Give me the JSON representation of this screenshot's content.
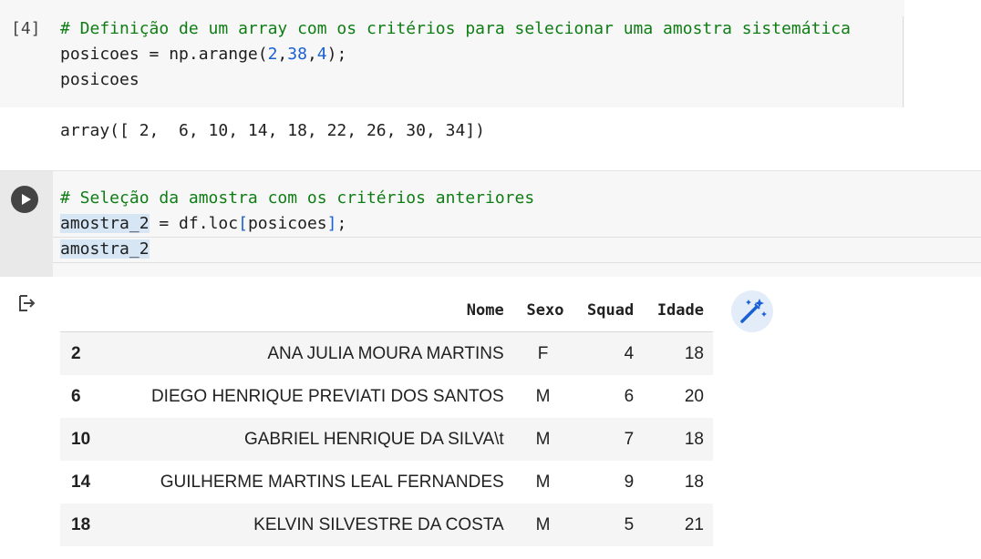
{
  "cell1": {
    "exec_count": "[4]",
    "comment": "# Definição de um array com os critérios para selecionar uma amostra sistemática",
    "line2_var": "posicoes = np.arange(",
    "line2_args": [
      "2",
      "38",
      "4"
    ],
    "line2_end": ");",
    "line3": "posicoes",
    "output": "array([ 2,  6, 10, 14, 18, 22, 26, 30, 34])"
  },
  "cell2": {
    "comment": "# Seleção da amostra com os critérios anteriores",
    "line2_var": "amostra_2",
    "line2_mid": " = df.loc",
    "line2_open": "[",
    "line2_arg": "posicoes",
    "line2_close": "]",
    "line2_end": ";",
    "line3": "amostra_2"
  },
  "table": {
    "columns": [
      "",
      "Nome",
      "Sexo",
      "Squad",
      "Idade"
    ],
    "rows": [
      {
        "idx": "2",
        "nome": "ANA JULIA MOURA MARTINS",
        "sexo": "F",
        "squad": "4",
        "idade": "18"
      },
      {
        "idx": "6",
        "nome": "DIEGO HENRIQUE PREVIATI DOS SANTOS",
        "sexo": "M",
        "squad": "6",
        "idade": "20"
      },
      {
        "idx": "10",
        "nome": "GABRIEL HENRIQUE DA SILVA\\t",
        "sexo": "M",
        "squad": "7",
        "idade": "18"
      },
      {
        "idx": "14",
        "nome": "GUILHERME MARTINS LEAL FERNANDES",
        "sexo": "M",
        "squad": "9",
        "idade": "18"
      },
      {
        "idx": "18",
        "nome": "KELVIN SILVESTRE DA COSTA",
        "sexo": "M",
        "squad": "5",
        "idade": "21"
      }
    ]
  },
  "icons": {
    "run": "play-icon",
    "output": "output-redirect-icon",
    "magic": "magic-wand-icon"
  },
  "colors": {
    "comment": "#0f7d15",
    "number": "#1a5fd4",
    "selection": "#d6e6f5"
  }
}
